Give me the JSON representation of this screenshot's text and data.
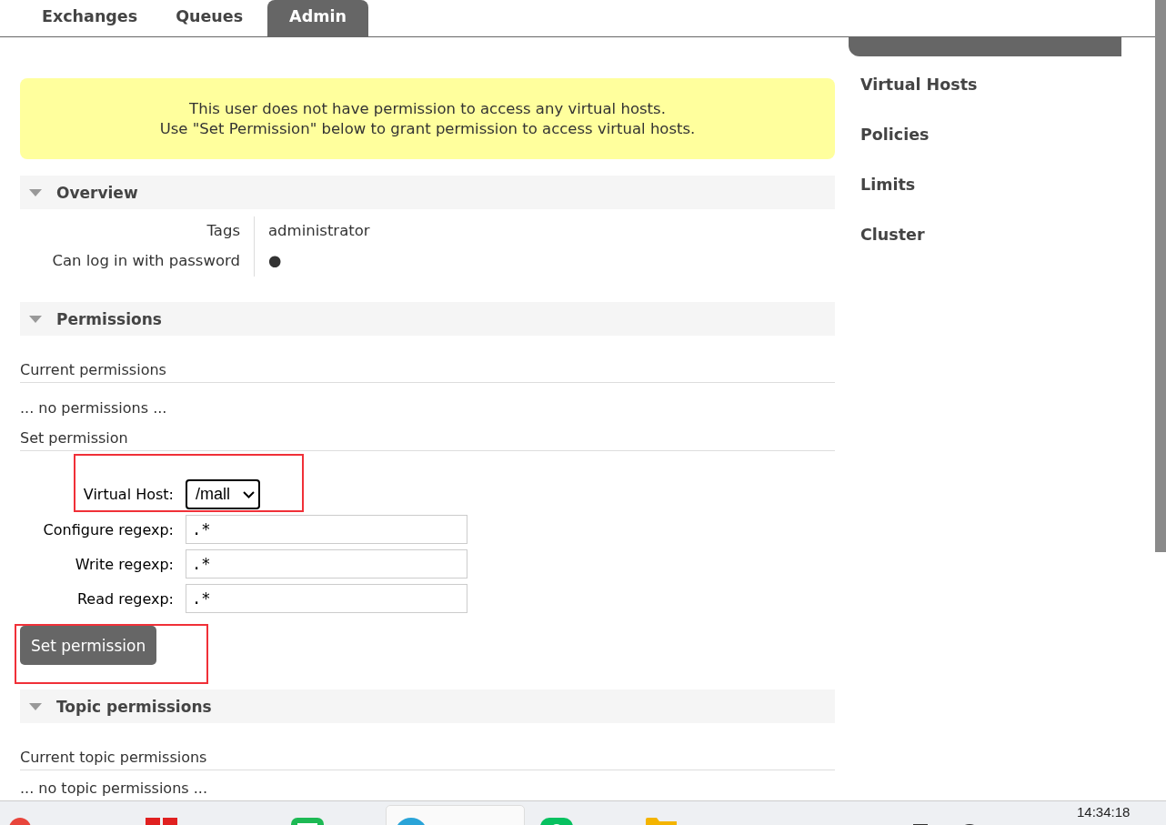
{
  "nav": {
    "tabs": [
      {
        "label": "Exchanges",
        "selected": false
      },
      {
        "label": "Queues",
        "selected": false
      },
      {
        "label": "Admin",
        "selected": true
      }
    ]
  },
  "sidebar": {
    "items": [
      {
        "selected": true
      },
      {
        "label": "Virtual Hosts",
        "selected": false
      },
      {
        "label": "Policies",
        "selected": false
      },
      {
        "label": "Limits",
        "selected": false
      },
      {
        "label": "Cluster",
        "selected": false
      }
    ]
  },
  "warning": {
    "lines": [
      "This user does not have permission to access any virtual hosts.",
      "Use \"Set Permission\" below to grant permission to access virtual hosts."
    ]
  },
  "overview": {
    "title": "Overview",
    "expanded": true,
    "rows": [
      {
        "label": "Tags",
        "value": "administrator"
      },
      {
        "label": "Can log in with password",
        "value": "●"
      }
    ]
  },
  "permissions": {
    "title": "Permissions",
    "expanded": true,
    "current_heading": "Current permissions",
    "empty_text": "... no permissions ...",
    "set_heading": "Set permission",
    "virtual_host": {
      "label": "Virtual Host:",
      "value": "/mall",
      "highlighted": true
    },
    "fields": [
      {
        "label": "Configure regexp:",
        "value": ".*"
      },
      {
        "label": "Write regexp:",
        "value": ".*"
      },
      {
        "label": "Read regexp:",
        "value": ".*"
      }
    ],
    "button": {
      "label": "Set permission",
      "highlighted": true
    }
  },
  "topic_permissions": {
    "title": "Topic permissions",
    "expanded": true,
    "current_heading": "Current topic permissions",
    "empty_text": "... no topic permissions ..."
  },
  "taskbar": {
    "time": "14:34:18"
  }
}
